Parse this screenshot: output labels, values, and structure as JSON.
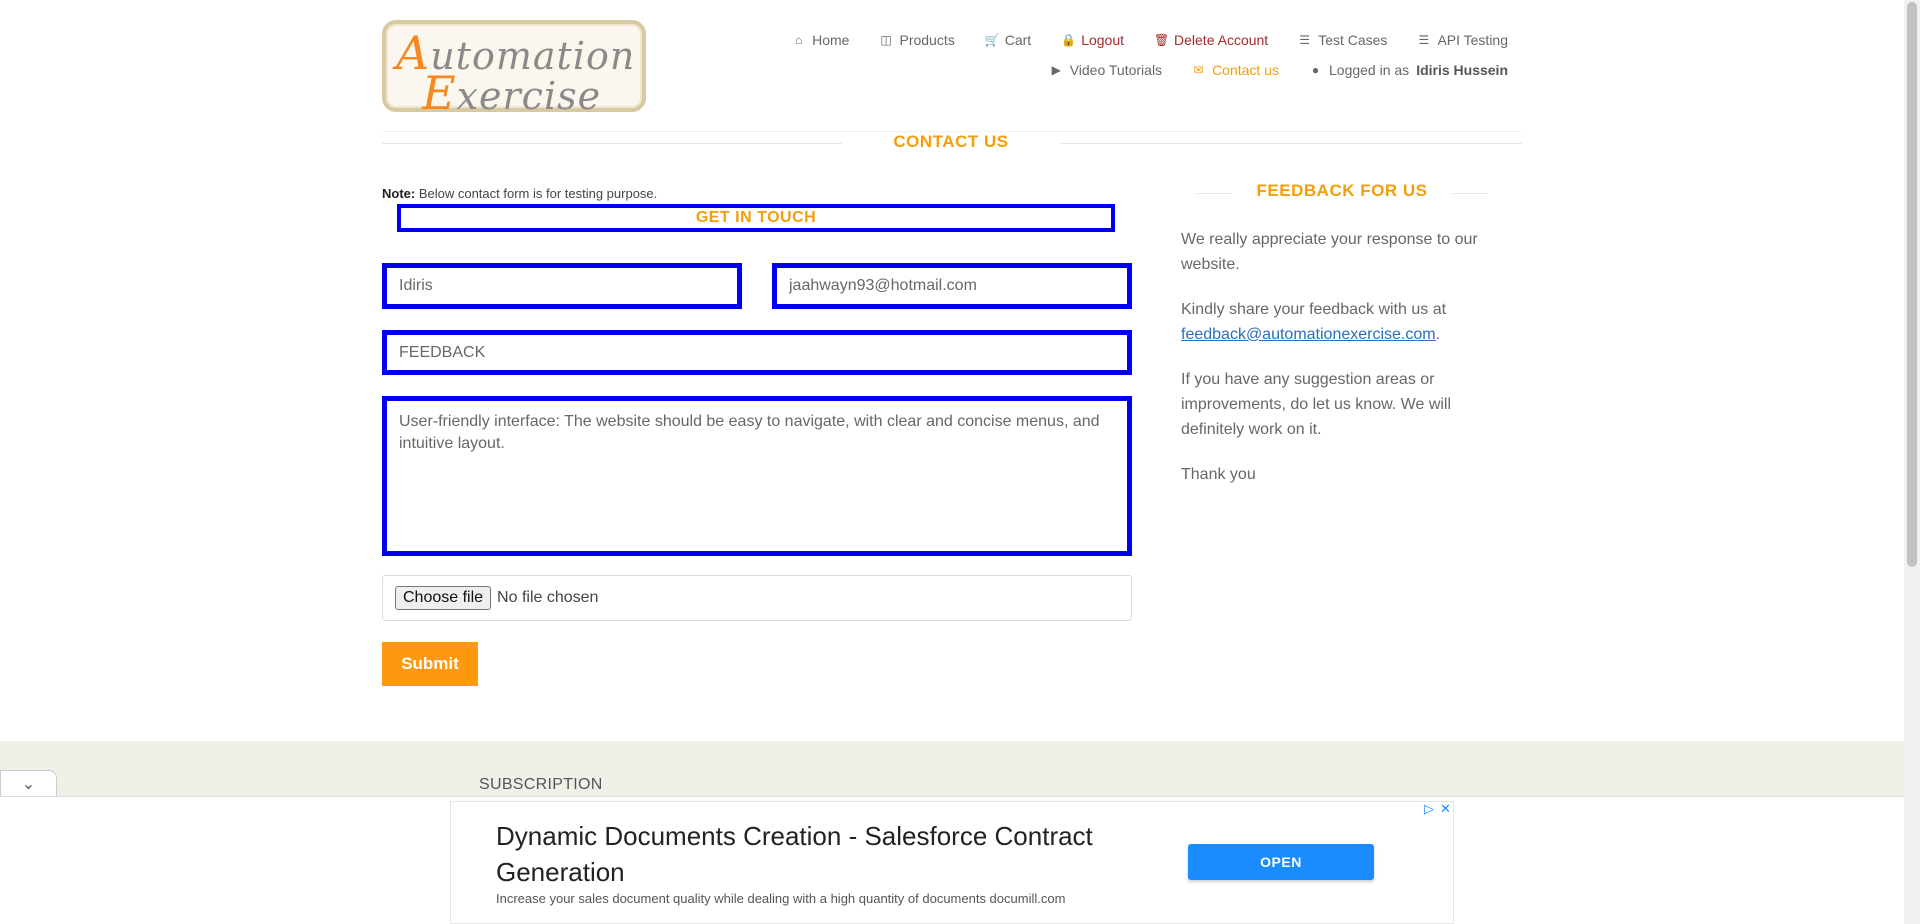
{
  "logo": {
    "line1_cap": "A",
    "line1_rest": "utomation",
    "line2_cap": "E",
    "line2_rest": "xercise"
  },
  "nav": {
    "row1": [
      {
        "icon": "home-icon",
        "glyph": "⌂",
        "label": "Home"
      },
      {
        "icon": "briefcase-icon",
        "glyph": "💼",
        "label": "Products"
      },
      {
        "icon": "cart-icon",
        "glyph": "🛒",
        "label": "Cart"
      },
      {
        "icon": "lock-icon",
        "glyph": "🔒",
        "label": "Logout"
      },
      {
        "icon": "trash-icon",
        "glyph": "🗑",
        "label": "Delete Account"
      },
      {
        "icon": "list-icon",
        "glyph": "☰",
        "label": "Test Cases"
      },
      {
        "icon": "list-icon",
        "glyph": "☰",
        "label": "API Testing"
      }
    ],
    "row2": [
      {
        "icon": "video-icon",
        "glyph": "▶",
        "label": "Video Tutorials"
      },
      {
        "icon": "envelope-icon",
        "glyph": "✉",
        "label": "Contact us"
      },
      {
        "icon": "user-icon",
        "glyph": "👤",
        "label_prefix": "Logged in as",
        "user": "Idiris Hussein"
      }
    ]
  },
  "section_title": "CONTACT US",
  "form": {
    "note_bold": "Note:",
    "note_text": " Below contact form is for testing purpose.",
    "heading": "GET IN TOUCH",
    "name_value": "Idiris",
    "email_value": "jaahwayn93@hotmail.com",
    "subject_value": "FEEDBACK",
    "message_value": "User-friendly interface: The website should be easy to navigate, with clear and concise menus, and intuitive layout.",
    "file_button": "Choose file",
    "file_status": "No file chosen",
    "submit_label": "Submit"
  },
  "feedback": {
    "title": "FEEDBACK FOR US",
    "p1": "We really appreciate your response to our website.",
    "p2_prefix": "Kindly share your feedback with us at ",
    "p2_email": "feedback@automationexercise.com",
    "p2_suffix": ".",
    "p3": "If you have any suggestion areas or improvements, do let us know. We will definitely work on it.",
    "p4": "Thank you"
  },
  "footer": {
    "subscription_title": "SUBSCRIPTION"
  },
  "ad": {
    "headline": "Dynamic Documents Creation - Salesforce Contract Generation",
    "description": "Increase your sales document quality while dealing with a high quantity of documents documill.com",
    "cta": "OPEN"
  },
  "colors": {
    "accent": "#fe980f",
    "highlight_border": "#0000ee",
    "danger": "#a52a2a",
    "ad_button": "#1a8cff"
  }
}
